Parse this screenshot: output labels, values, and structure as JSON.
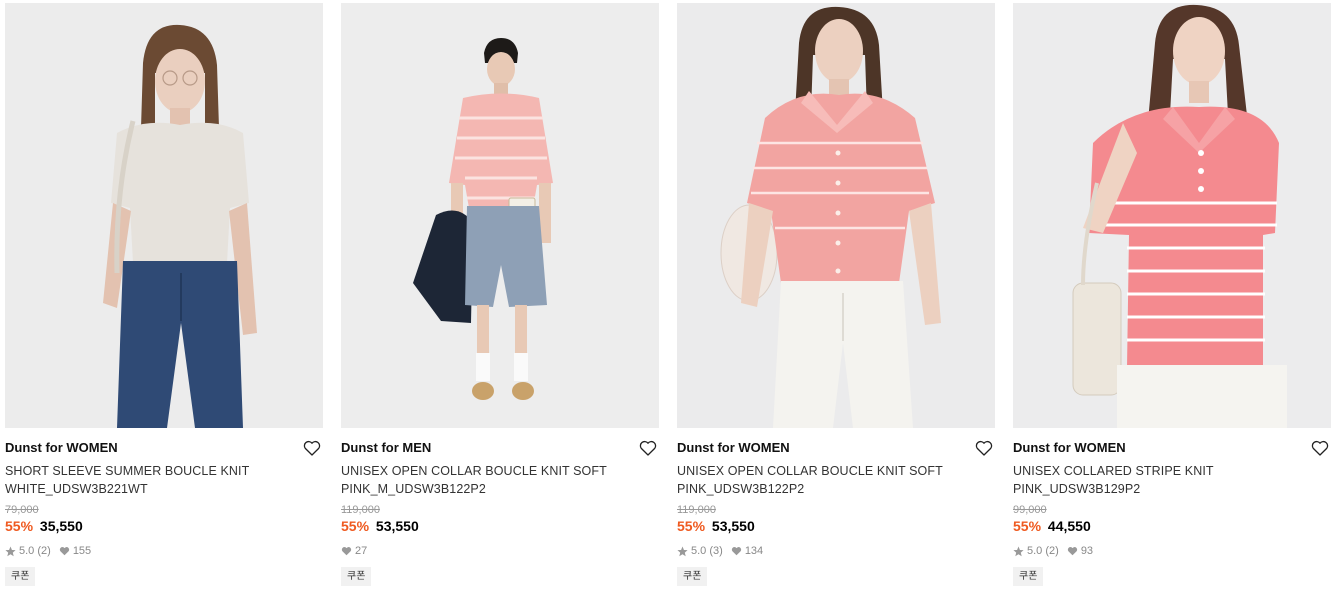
{
  "products": [
    {
      "brand": "Dunst for WOMEN",
      "title": "SHORT SLEEVE SUMMER BOUCLE KNIT WHITE_UDSW3B221WT",
      "original_price": "79,000",
      "discount": "55%",
      "price": "35,550",
      "rating": "5.0",
      "reviews": "(2)",
      "likes": "155",
      "coupon": "쿠폰",
      "image": "woman-white-knit-jeans"
    },
    {
      "brand": "Dunst for MEN",
      "title": "UNISEX OPEN COLLAR BOUCLE KNIT SOFT PINK_M_UDSW3B122P2",
      "original_price": "119,000",
      "discount": "55%",
      "price": "53,550",
      "likes": "27",
      "coupon": "쿠폰",
      "image": "man-pink-knit-denim-shorts"
    },
    {
      "brand": "Dunst for WOMEN",
      "title": "UNISEX OPEN COLLAR BOUCLE KNIT SOFT PINK_UDSW3B122P2",
      "original_price": "119,000",
      "discount": "55%",
      "price": "53,550",
      "rating": "5.0",
      "reviews": "(3)",
      "likes": "134",
      "coupon": "쿠폰",
      "image": "woman-pink-knit-white-pants"
    },
    {
      "brand": "Dunst for WOMEN",
      "title": "UNISEX COLLARED STRIPE KNIT PINK_UDSW3B129P2",
      "original_price": "99,000",
      "discount": "55%",
      "price": "44,550",
      "rating": "5.0",
      "reviews": "(2)",
      "likes": "93",
      "coupon": "쿠폰",
      "image": "woman-pink-stripe-polo"
    }
  ],
  "colors": {
    "discount": "#ef5a20",
    "photo_bg": "#eeeeef",
    "pink_knit": "#f4a9a6",
    "denim": "#3a5377"
  }
}
